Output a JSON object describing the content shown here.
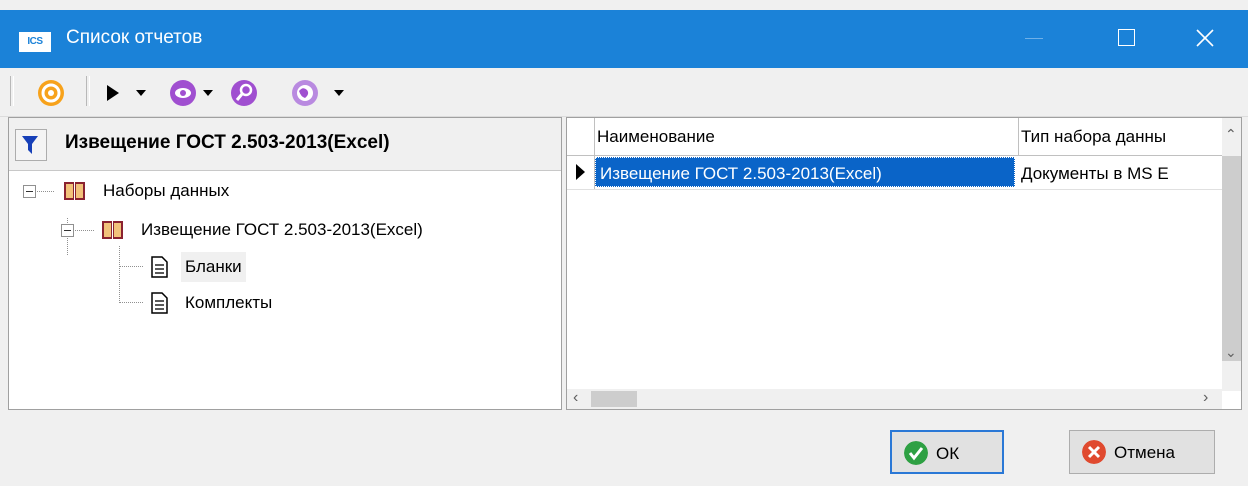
{
  "window": {
    "app_icon_text": "ICS",
    "title": "Список отчетов"
  },
  "left_panel": {
    "title": "Извещение ГОСТ 2.503-2013(Excel)",
    "tree": [
      {
        "label": "Наборы данных"
      },
      {
        "label": "Извещение ГОСТ 2.503-2013(Excel)"
      },
      {
        "label": "Бланки"
      },
      {
        "label": "Комплекты"
      }
    ]
  },
  "grid": {
    "columns": [
      "Наименование",
      "Тип набора данны"
    ],
    "rows": [
      {
        "name": "Извещение ГОСТ 2.503-2013(Excel)",
        "type": "Документы в MS E"
      }
    ]
  },
  "buttons": {
    "ok": "ОК",
    "cancel": "Отмена"
  },
  "colors": {
    "titlebar": "#1b82d8",
    "selection": "#0a64c8",
    "ok_icon": "#2ea043",
    "cancel_icon": "#e04a2f"
  }
}
